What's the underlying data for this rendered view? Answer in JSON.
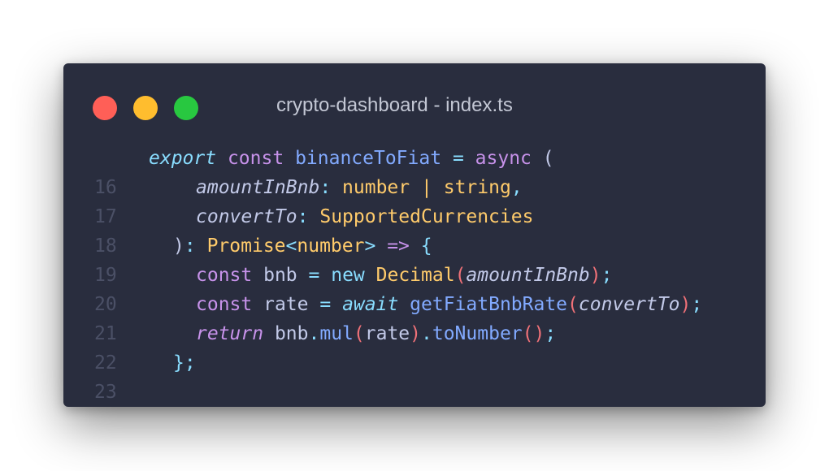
{
  "window": {
    "title": "crypto-dashboard - index.ts",
    "controls": [
      "close",
      "minimize",
      "maximize"
    ]
  },
  "colors": {
    "background": "#292d3e",
    "close": "#ff5f57",
    "minimize": "#ffbd2e",
    "maximize": "#28c840"
  },
  "code": {
    "language": "typescript",
    "lines": [
      {
        "number": "16",
        "tokens": [
          "export",
          " ",
          "const",
          " ",
          "binanceToFiat",
          " ",
          "=",
          " ",
          "async",
          " ",
          "("
        ]
      },
      {
        "number": "17",
        "tokens": [
          "amountInBnb",
          ":",
          " ",
          "number",
          " ",
          "|",
          " ",
          "string",
          ","
        ]
      },
      {
        "number": "18",
        "tokens": [
          "convertTo",
          ":",
          " ",
          "SupportedCurrencies"
        ]
      },
      {
        "number": "19",
        "tokens": [
          ")",
          ":",
          " ",
          "Promise",
          "<",
          "number",
          ">",
          " ",
          "=>",
          " ",
          "{"
        ]
      },
      {
        "number": "20",
        "tokens": [
          "const",
          " bnb ",
          "=",
          " ",
          "new",
          " ",
          "Decimal",
          "(",
          "amountInBnb",
          ")",
          ";"
        ]
      },
      {
        "number": "21",
        "tokens": [
          "const",
          " rate ",
          "=",
          " ",
          "await",
          " ",
          "getFiatBnbRate",
          "(",
          "convertTo",
          ")",
          ";"
        ]
      },
      {
        "number": "22",
        "tokens": [
          "return",
          " bnb",
          ".",
          "mul",
          "(",
          "rate",
          ")",
          ".",
          "toNumber",
          "()",
          ";"
        ]
      },
      {
        "number": "23",
        "tokens": [
          "}",
          ";"
        ]
      }
    ]
  }
}
